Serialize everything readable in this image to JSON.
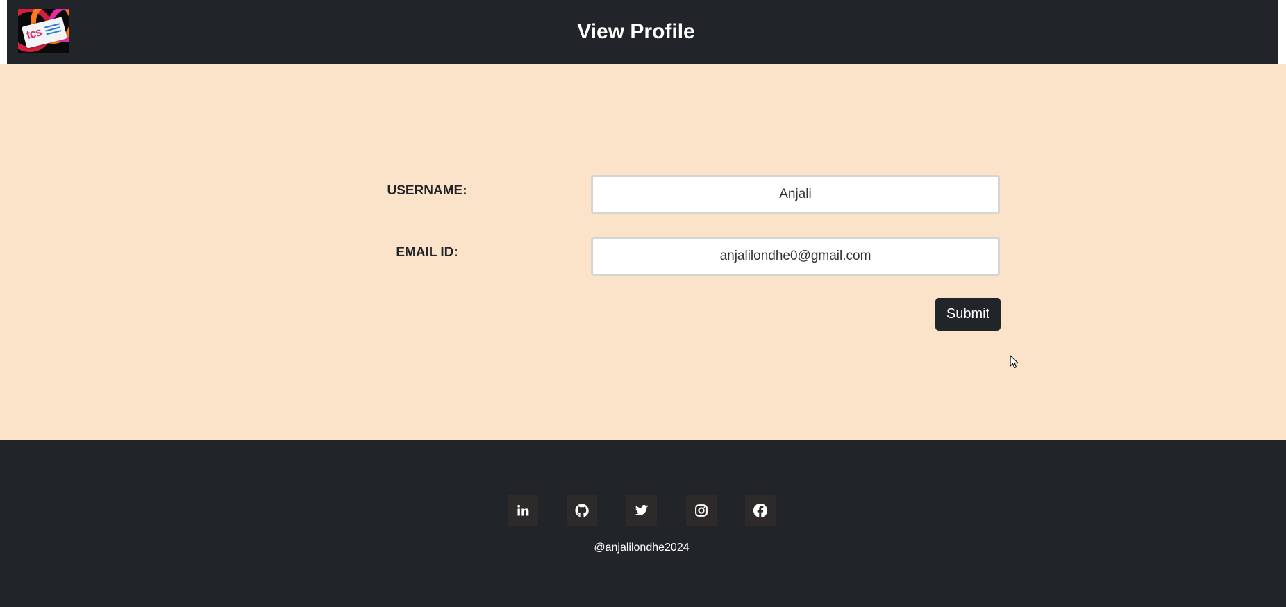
{
  "header": {
    "title": "View Profile",
    "logo_text": "tcs"
  },
  "form": {
    "username_label": "USERNAME:",
    "username_value": "Anjali",
    "email_label": "EMAIL ID:",
    "email_value": "anjalilondhe0@gmail.com",
    "submit_label": "Submit"
  },
  "footer": {
    "social_links": [
      {
        "icon": "linkedin-icon"
      },
      {
        "icon": "github-icon"
      },
      {
        "icon": "twitter-icon"
      },
      {
        "icon": "instagram-icon"
      },
      {
        "icon": "facebook-icon"
      }
    ],
    "handle": "@anjalilondhe2024"
  },
  "colors": {
    "header_bg": "#212429",
    "main_bg": "#fae3c8",
    "footer_bg": "#212429",
    "button_bg": "#212429",
    "social_bg": "#2e2a2a"
  }
}
